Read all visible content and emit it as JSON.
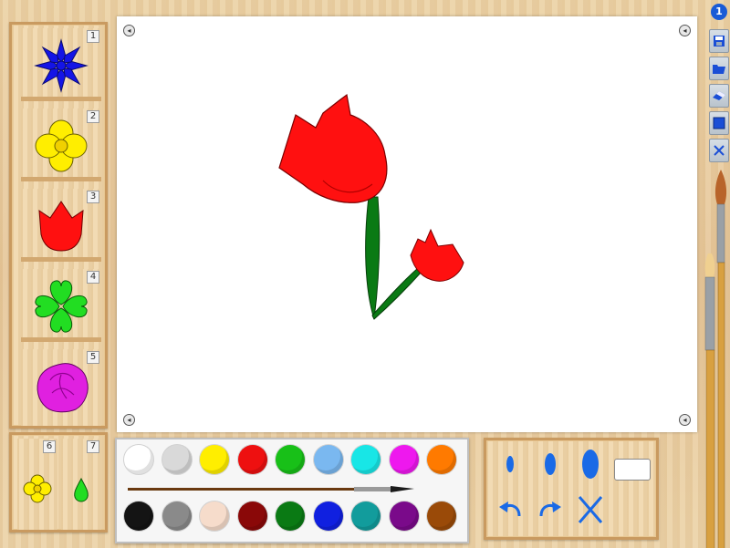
{
  "app": {
    "badge": "1"
  },
  "shapes": [
    {
      "num": "1",
      "name": "cornflower",
      "color": "#1414e6"
    },
    {
      "num": "2",
      "name": "yellow-flower",
      "color": "#ffee00"
    },
    {
      "num": "3",
      "name": "tulip",
      "color": "#ff1010"
    },
    {
      "num": "4",
      "name": "clover",
      "color": "#22dd22"
    },
    {
      "num": "5",
      "name": "rose",
      "color": "#e020e0"
    }
  ],
  "mini_shapes": [
    {
      "num": "6",
      "name": "small-flower",
      "color": "#ffee00"
    },
    {
      "num": "7",
      "name": "leaf",
      "color": "#22dd22"
    }
  ],
  "palette": {
    "top_row": [
      "#ffffff",
      "#d9d9d9",
      "#ffee00",
      "#ee1010",
      "#18c018",
      "#7ab8f0",
      "#18e6e6",
      "#ee18ee",
      "#ff7a00"
    ],
    "bottom_row": [
      "#141414",
      "#8a8a8a",
      "#f6dccb",
      "#8a0808",
      "#0a7a14",
      "#1020e0",
      "#129c9c",
      "#7a0a8a",
      "#9a4a08"
    ]
  },
  "tools": {
    "brush_sizes": [
      "small",
      "medium",
      "large"
    ],
    "actions": [
      "undo-icon",
      "redo-icon",
      "clear-icon"
    ],
    "selected_color": "#ffffff"
  },
  "toolbar": {
    "buttons": [
      "save-icon",
      "open-icon",
      "eraser-icon",
      "fill-icon",
      "close-icon"
    ]
  },
  "canvas": {
    "drawing": "tulip-pair",
    "flower_color": "#ff1010",
    "stem_color": "#0a7a14"
  }
}
